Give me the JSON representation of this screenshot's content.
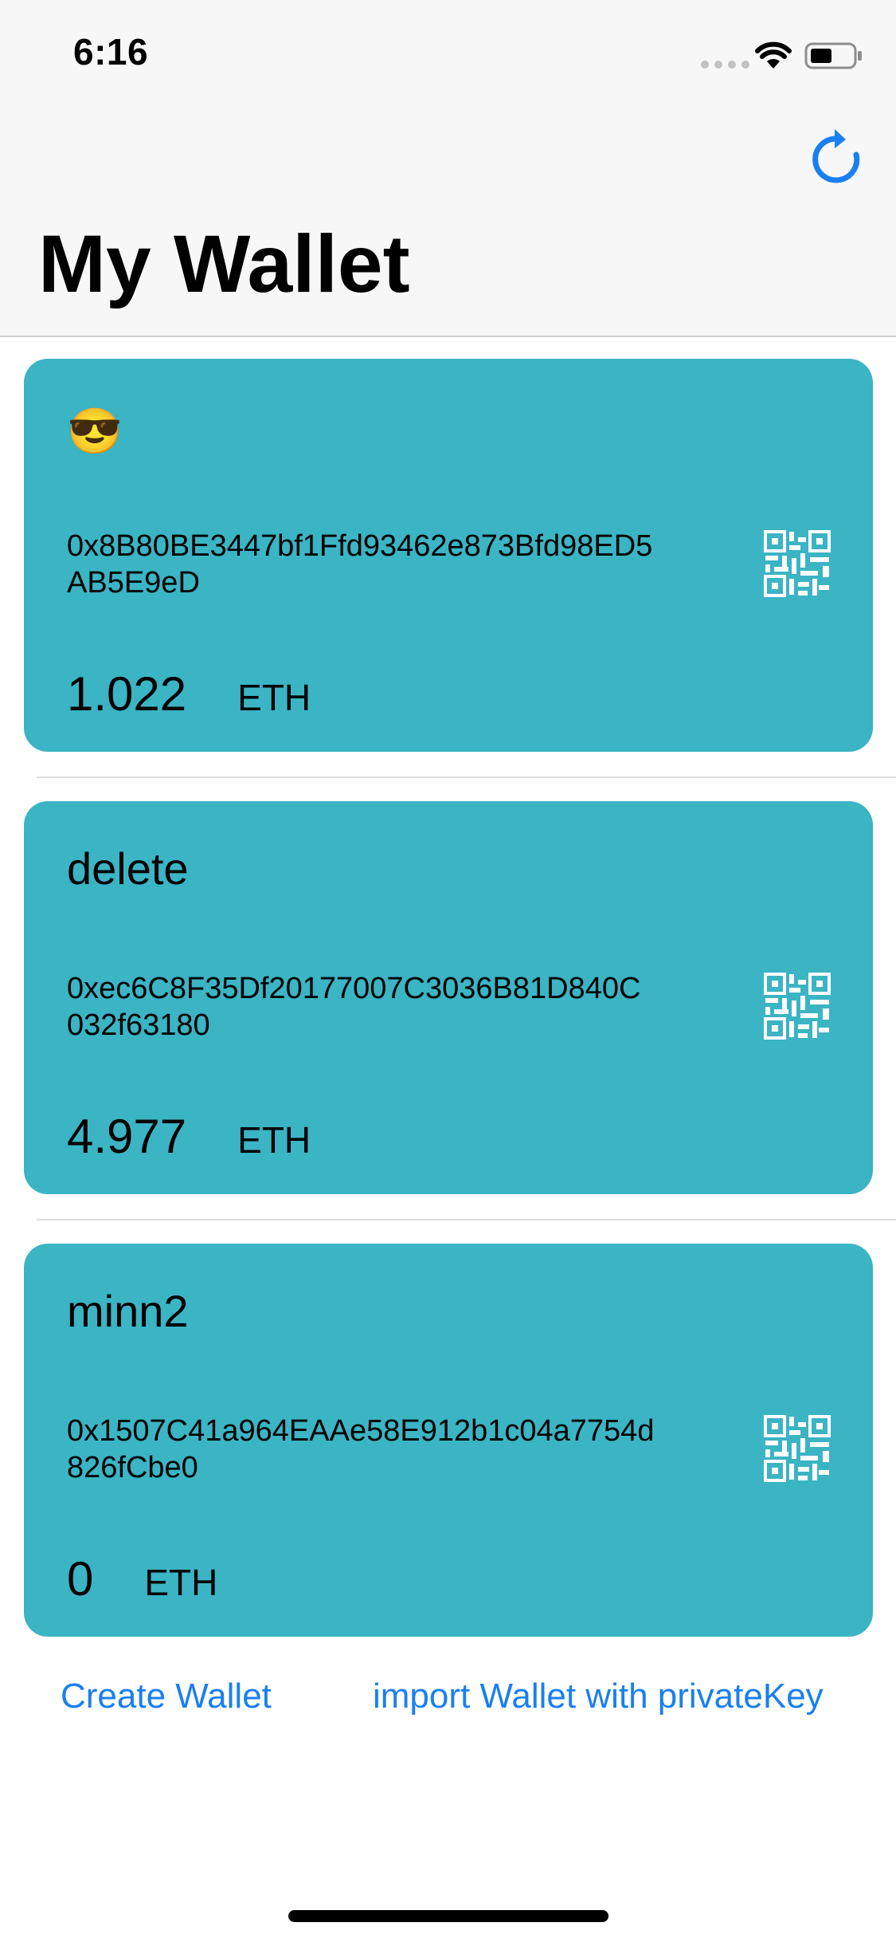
{
  "status_bar": {
    "time": "6:16",
    "battery_icon": "battery-icon",
    "wifi_icon": "wifi-icon"
  },
  "nav": {
    "title": "My Wallet",
    "refresh_icon": "refresh-icon",
    "accent_color": "#1a7ff0"
  },
  "card_color": "#3bb4c4",
  "wallets": [
    {
      "name": "😎",
      "address": "0x8B80BE3447bf1Ffd93462e873Bfd98ED5AB5E9eD",
      "balance": "1.022",
      "unit": "ETH"
    },
    {
      "name": "delete",
      "address": "0xec6C8F35Df20177007C3036B81D840C032f63180",
      "balance": "4.977",
      "unit": "ETH"
    },
    {
      "name": "minn2",
      "address": "0x1507C41a964EAAe58E912b1c04a7754d826fCbe0",
      "balance": "0",
      "unit": "ETH"
    }
  ],
  "actions": {
    "create_label": "Create Wallet",
    "import_label": "import Wallet with privateKey"
  }
}
